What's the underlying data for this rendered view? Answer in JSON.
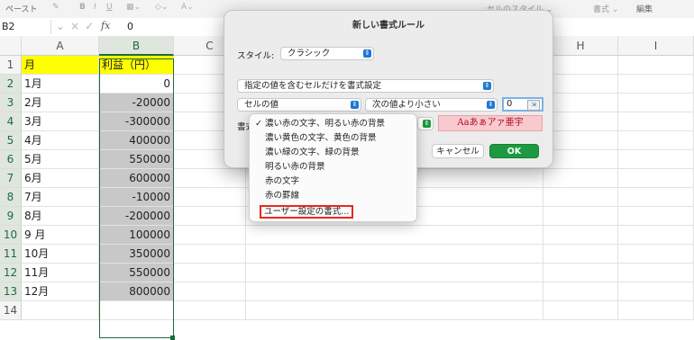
{
  "ribbon": {
    "paste_label": "ペースト",
    "cell_style_label": "セルのスタイル ⌄",
    "format_label": "書式 ⌄",
    "edit_label": "編集"
  },
  "formula_bar": {
    "name_box": "B2",
    "fx": "fx",
    "value": "0"
  },
  "columns": [
    "A",
    "B",
    "C",
    "H",
    "I"
  ],
  "rows": [
    {
      "num": "1",
      "a": "月",
      "b": "利益（円）"
    },
    {
      "num": "2",
      "a": "1月",
      "b": "0"
    },
    {
      "num": "3",
      "a": "2月",
      "b": "-20000"
    },
    {
      "num": "4",
      "a": "3月",
      "b": "-300000"
    },
    {
      "num": "5",
      "a": "4月",
      "b": "400000"
    },
    {
      "num": "6",
      "a": "5月",
      "b": "550000"
    },
    {
      "num": "7",
      "a": "6月",
      "b": "600000"
    },
    {
      "num": "8",
      "a": "7月",
      "b": "-10000"
    },
    {
      "num": "9",
      "a": "8月",
      "b": "-200000"
    },
    {
      "num": "10",
      "a": "9 月",
      "b": "100000"
    },
    {
      "num": "11",
      "a": "10月",
      "b": "350000"
    },
    {
      "num": "12",
      "a": "11月",
      "b": "550000"
    },
    {
      "num": "13",
      "a": "12月",
      "b": "800000"
    },
    {
      "num": "14",
      "a": "",
      "b": ""
    }
  ],
  "dialog": {
    "title": "新しい書式ルール",
    "style_label": "スタイル:",
    "style_value": "クラシック",
    "rule_type": "指定の値を含むセルだけを書式設定",
    "condition_field": "セルの値",
    "operator": "次の値より小さい",
    "value": "0",
    "format_label": "書式",
    "preview_text": "Aaあぁアァ亜宇",
    "cancel_label": "キャンセル",
    "ok_label": "OK"
  },
  "format_menu": {
    "items": [
      "濃い赤の文字、明るい赤の背景",
      "濃い黄色の文字、黄色の背景",
      "濃い緑の文字、緑の背景",
      "明るい赤の背景",
      "赤の文字",
      "赤の罫線",
      "ユーザー設定の書式..."
    ],
    "checked_index": 0
  },
  "colors": {
    "accent_green": "#1d6b3b",
    "header_yellow": "#ffff00",
    "negative_gray": "#c8c8c8",
    "ok_green": "#1d9a3f",
    "highlight_red": "#e8281c"
  }
}
